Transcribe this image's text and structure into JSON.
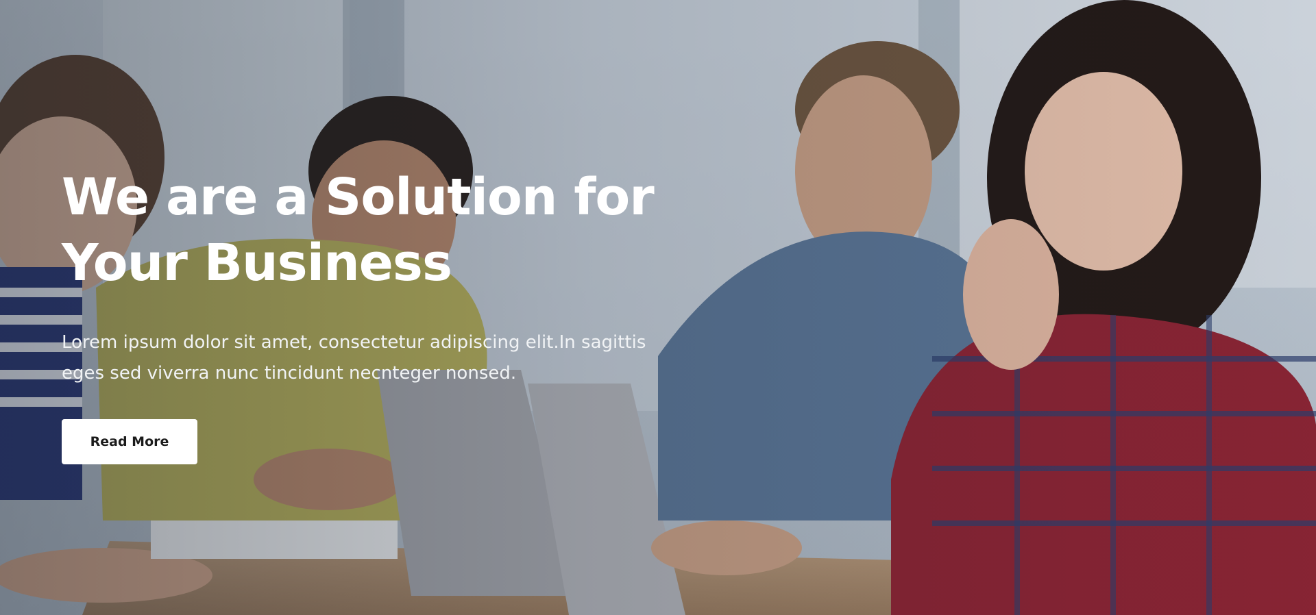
{
  "hero": {
    "headline_line1": "We are a Solution for",
    "headline_line2": "Your Business",
    "description_line1": "Lorem ipsum dolor sit amet, consectetur adipiscing elit.In sagittis",
    "description_line2": "eges sed viverra nunc tincidunt necnteger nonsed.",
    "cta_label": "Read More"
  },
  "colors": {
    "headline": "#ffffff",
    "button_bg": "#ffffff",
    "button_text": "#1b1b1b"
  }
}
